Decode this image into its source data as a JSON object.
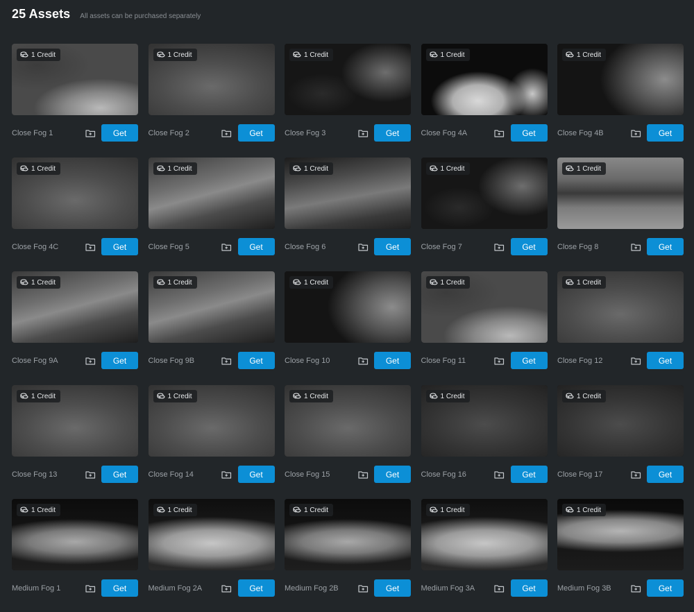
{
  "header": {
    "title": "25 Assets",
    "subtitle": "All assets can be purchased separately"
  },
  "icons": {
    "credit": "coins-icon",
    "collection": "folder-plus-icon"
  },
  "colors": {
    "background": "#222629",
    "accent": "#0c8fd6"
  },
  "assets": [
    {
      "name": "Close Fog 1",
      "credit": "1 Credit",
      "action": "Get",
      "style": "light-bottom"
    },
    {
      "name": "Close Fog 2",
      "credit": "1 Credit",
      "action": "Get",
      "style": "haze"
    },
    {
      "name": "Close Fog 3",
      "credit": "1 Credit",
      "action": "Get",
      "style": "dark-wisp"
    },
    {
      "name": "Close Fog 4A",
      "credit": "1 Credit",
      "action": "Get",
      "style": "bright-cloud"
    },
    {
      "name": "Close Fog 4B",
      "credit": "1 Credit",
      "action": "Get",
      "style": "right-glow"
    },
    {
      "name": "Close Fog 4C",
      "credit": "1 Credit",
      "action": "Get",
      "style": "haze"
    },
    {
      "name": "Close Fog 5",
      "credit": "1 Credit",
      "action": "Get",
      "style": "streak"
    },
    {
      "name": "Close Fog 6",
      "credit": "1 Credit",
      "action": "Get",
      "style": "streak-dark"
    },
    {
      "name": "Close Fog 7",
      "credit": "1 Credit",
      "action": "Get",
      "style": "dark-wisp"
    },
    {
      "name": "Close Fog 8",
      "credit": "1 Credit",
      "action": "Get",
      "style": "band"
    },
    {
      "name": "Close Fog 9A",
      "credit": "1 Credit",
      "action": "Get",
      "style": "streak"
    },
    {
      "name": "Close Fog 9B",
      "credit": "1 Credit",
      "action": "Get",
      "style": "streak"
    },
    {
      "name": "Close Fog 10",
      "credit": "1 Credit",
      "action": "Get",
      "style": "right-glow"
    },
    {
      "name": "Close Fog 11",
      "credit": "1 Credit",
      "action": "Get",
      "style": "light-bottom"
    },
    {
      "name": "Close Fog 12",
      "credit": "1 Credit",
      "action": "Get",
      "style": "haze"
    },
    {
      "name": "Close Fog 13",
      "credit": "1 Credit",
      "action": "Get",
      "style": "haze"
    },
    {
      "name": "Close Fog 14",
      "credit": "1 Credit",
      "action": "Get",
      "style": "haze"
    },
    {
      "name": "Close Fog 15",
      "credit": "1 Credit",
      "action": "Get",
      "style": "haze"
    },
    {
      "name": "Close Fog 16",
      "credit": "1 Credit",
      "action": "Get",
      "style": "dark-haze"
    },
    {
      "name": "Close Fog 17",
      "credit": "1 Credit",
      "action": "Get",
      "style": "dark-haze"
    },
    {
      "name": "Medium Fog 1",
      "credit": "1 Credit",
      "action": "Get",
      "style": "cloud-row"
    },
    {
      "name": "Medium Fog 2A",
      "credit": "1 Credit",
      "action": "Get",
      "style": "cloud-row-bright"
    },
    {
      "name": "Medium Fog 2B",
      "credit": "1 Credit",
      "action": "Get",
      "style": "cloud-row"
    },
    {
      "name": "Medium Fog 3A",
      "credit": "1 Credit",
      "action": "Get",
      "style": "cloud-row-bright"
    },
    {
      "name": "Medium Fog 3B",
      "credit": "1 Credit",
      "action": "Get",
      "style": "cloud-band"
    }
  ]
}
